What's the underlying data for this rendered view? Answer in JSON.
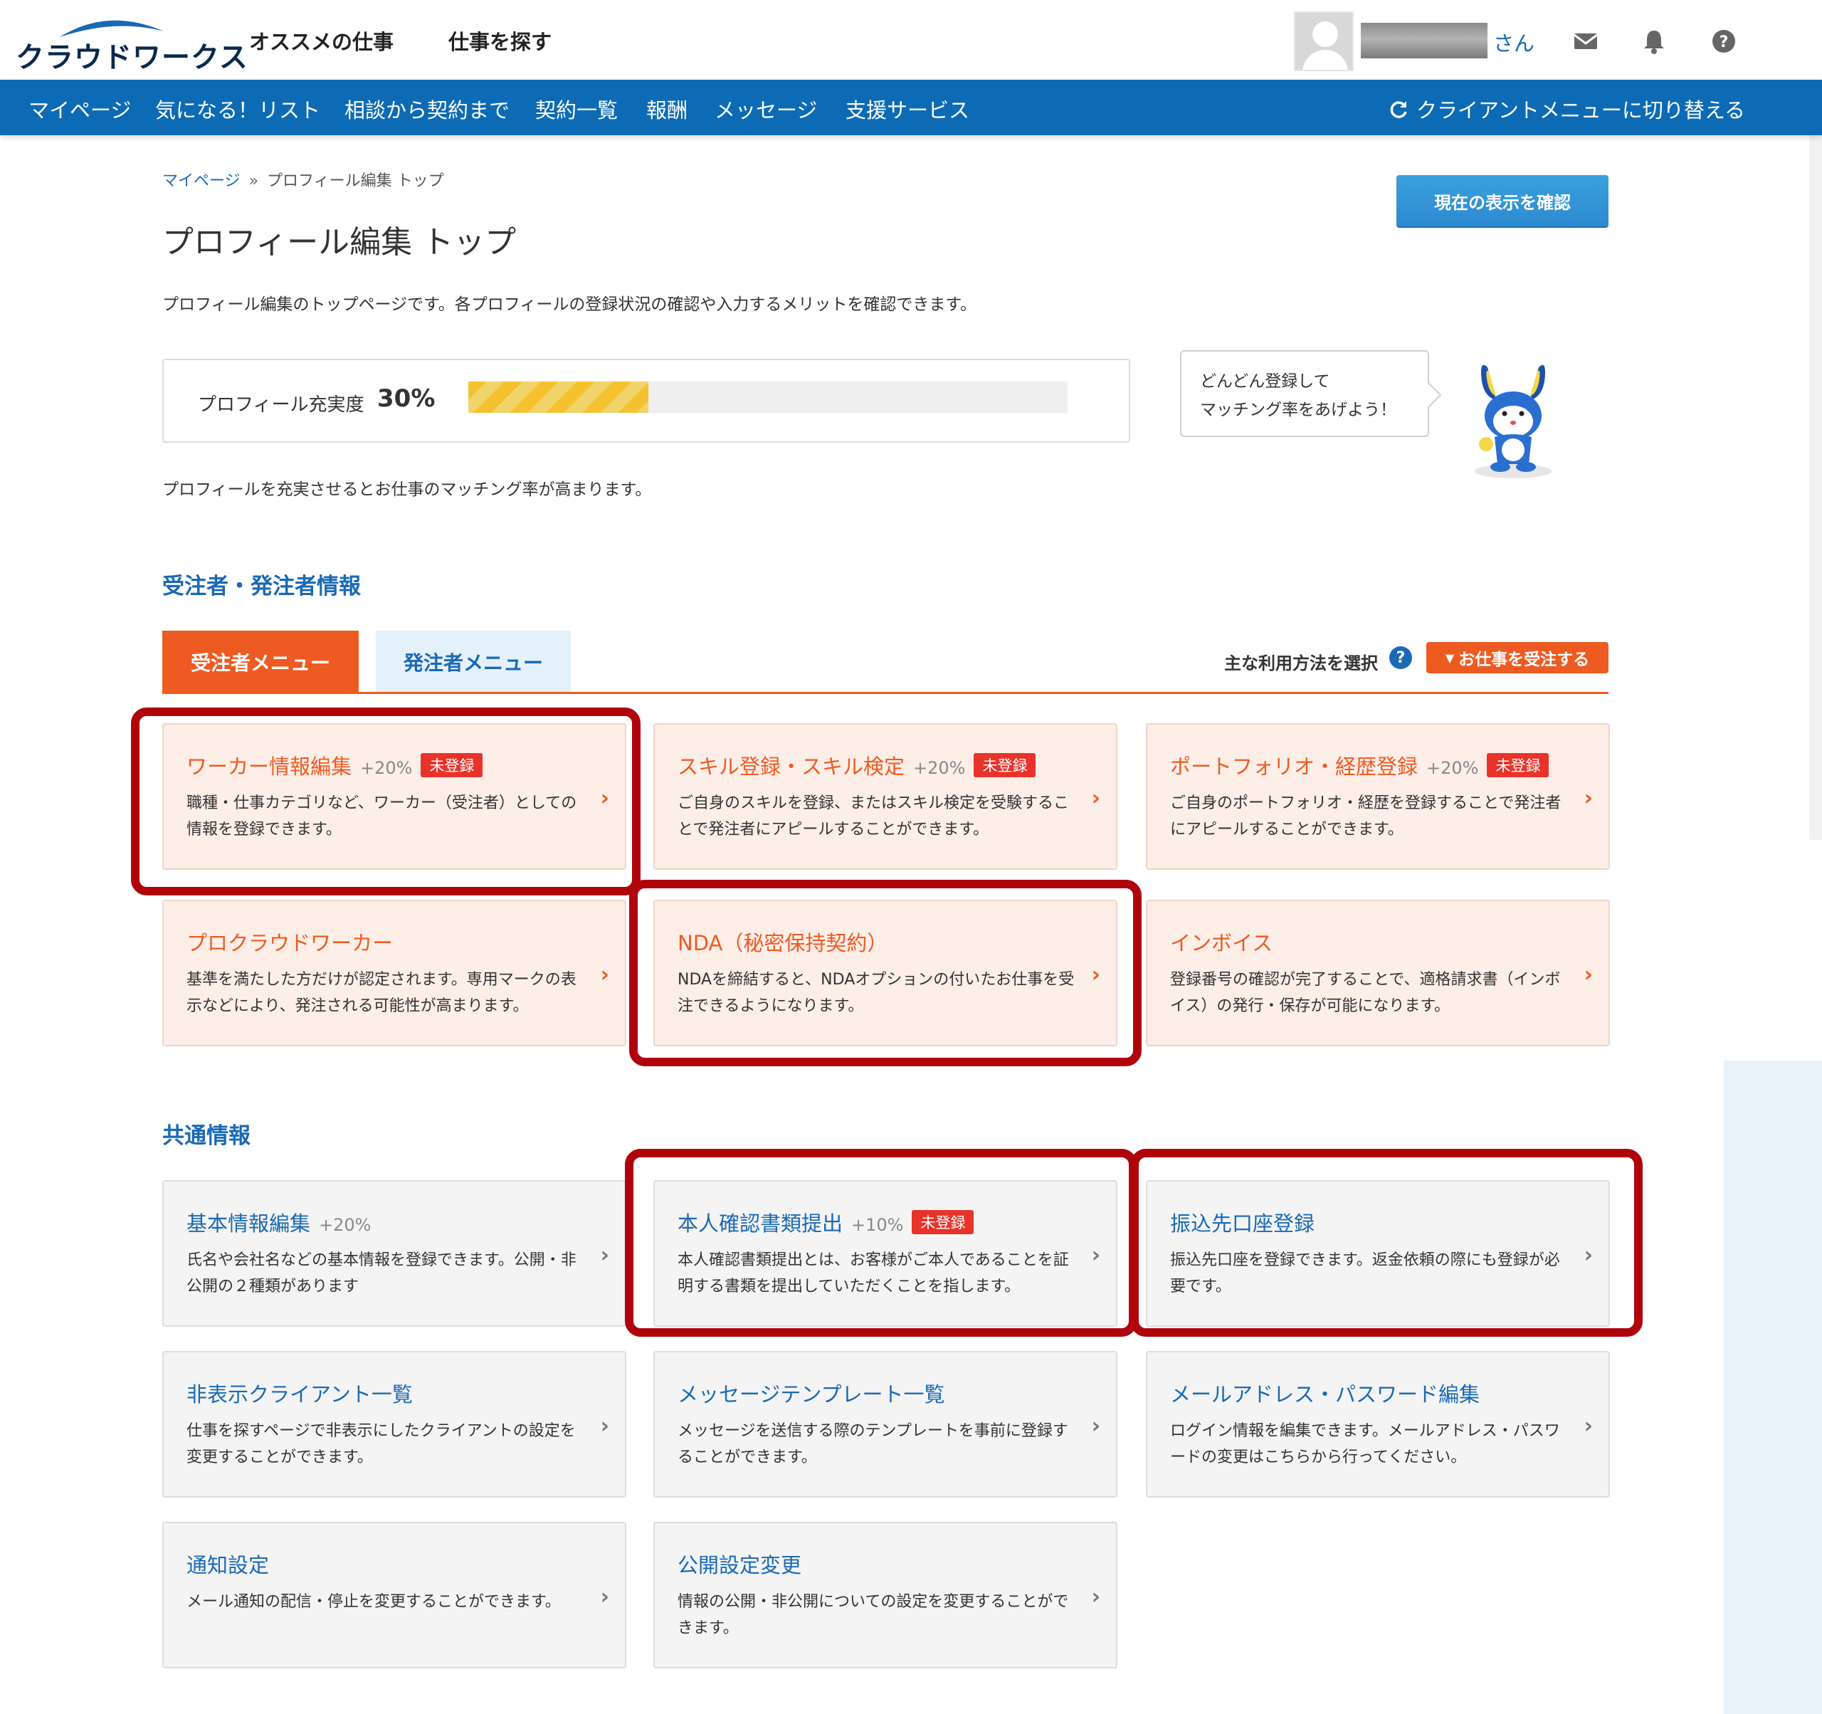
{
  "header": {
    "logo_text": "クラウドワークス",
    "nav": [
      "オススメの仕事",
      "仕事を探す"
    ],
    "user_suffix": "さん",
    "icons": [
      "mail-icon",
      "bell-icon",
      "help-icon"
    ]
  },
  "mainnav": {
    "items": [
      "マイページ",
      "気になる！リスト",
      "相談から契約まで",
      "契約一覧",
      "報酬",
      "メッセージ",
      "支援サービス"
    ],
    "switch_label": "クライアントメニューに切り替える"
  },
  "breadcrumb": {
    "home": "マイページ",
    "separator": "»",
    "current": "プロフィール編集 トップ"
  },
  "page": {
    "title": "プロフィール編集 トップ",
    "confirm_button": "現在の表示を確認",
    "description": "プロフィール編集のトップページです。各プロフィールの登録状況の確認や入力するメリットを確認できます。"
  },
  "progress": {
    "label": "プロフィール充実度",
    "percent_label": "30%",
    "fill_fraction": 0.3,
    "note": "プロフィールを充実させるとお仕事のマッチング率が高まります。",
    "bubble_line1": "どんどん登録して",
    "bubble_line2": "マッチング率をあげよう！"
  },
  "section1": {
    "title": "受注者・発注者情報",
    "tabs": [
      "受注者メニュー",
      "発注者メニュー"
    ],
    "usage_label": "主な利用方法を選択",
    "role_select": "お仕事を受注する",
    "cards": [
      {
        "title": "ワーカー情報編集",
        "pct": "+20%",
        "badge": "未登録",
        "desc": "職種・仕事カテゴリなど、ワーカー（受注者）としての情報を登録できます。"
      },
      {
        "title": "スキル登録・スキル検定",
        "pct": "+20%",
        "badge": "未登録",
        "desc": "ご自身のスキルを登録、またはスキル検定を受験することで発注者にアピールすることができます。"
      },
      {
        "title": "ポートフォリオ・経歴登録",
        "pct": "+20%",
        "badge": "未登録",
        "desc": "ご自身のポートフォリオ・経歴を登録することで発注者にアピールすることができます。"
      },
      {
        "title": "プロクラウドワーカー",
        "pct": "",
        "badge": "",
        "desc": "基準を満たした方だけが認定されます。専用マークの表示などにより、発注される可能性が高まります。"
      },
      {
        "title": "NDA（秘密保持契約）",
        "pct": "",
        "badge": "",
        "desc": "NDAを締結すると、NDAオプションの付いたお仕事を受注できるようになります。"
      },
      {
        "title": "インボイス",
        "pct": "",
        "badge": "",
        "desc": "登録番号の確認が完了することで、適格請求書（インボイス）の発行・保存が可能になります。"
      }
    ]
  },
  "section2": {
    "title": "共通情報",
    "cards": [
      {
        "title": "基本情報編集",
        "pct": "+20%",
        "badge": "",
        "desc": "氏名や会社名などの基本情報を登録できます。公開・非公開の２種類があります"
      },
      {
        "title": "本人確認書類提出",
        "pct": "+10%",
        "badge": "未登録",
        "desc": "本人確認書類提出とは、お客様がご本人であることを証明する書類を提出していただくことを指します。"
      },
      {
        "title": "振込先口座登録",
        "pct": "",
        "badge": "",
        "desc": "振込先口座を登録できます。返金依頼の際にも登録が必要です。"
      },
      {
        "title": "非表示クライアント一覧",
        "pct": "",
        "badge": "",
        "desc": "仕事を探すページで非表示にしたクライアントの設定を変更することができます。"
      },
      {
        "title": "メッセージテンプレート一覧",
        "pct": "",
        "badge": "",
        "desc": "メッセージを送信する際のテンプレートを事前に登録することができます。"
      },
      {
        "title": "メールアドレス・パスワード編集",
        "pct": "",
        "badge": "",
        "desc": "ログイン情報を編集できます。メールアドレス・パスワードの変更はこちらから行ってください。"
      },
      {
        "title": "通知設定",
        "pct": "",
        "badge": "",
        "desc": "メール通知の配信・停止を変更することができます。"
      },
      {
        "title": "公開設定変更",
        "pct": "",
        "badge": "",
        "desc": "情報の公開・非公開についての設定を変更することができます。"
      }
    ]
  },
  "colors": {
    "accent_orange": "#ee5b22",
    "brand_blue": "#0d6bb5",
    "link_blue": "#1a69b5",
    "badge_red": "#e8332a",
    "highlight_red": "#b0040d"
  }
}
